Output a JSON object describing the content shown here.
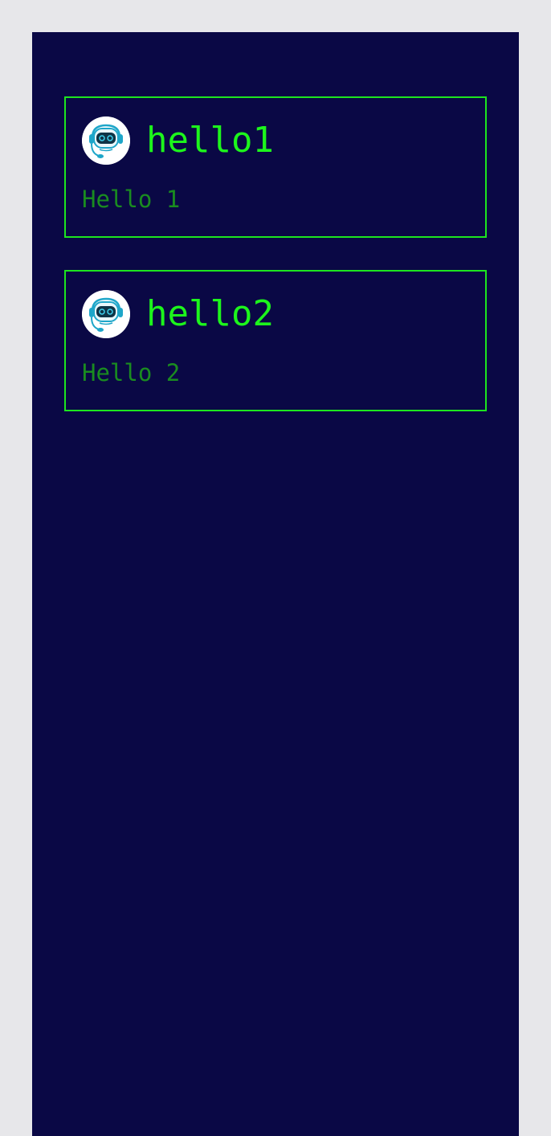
{
  "colors": {
    "outer_background": "#e7e7ea",
    "panel_background": "#0a0845",
    "card_border": "#1de51f",
    "title_text": "#1df51c",
    "body_text": "#1a8c20"
  },
  "cards": [
    {
      "avatar_icon": "robot-headset-icon",
      "title": "hello1",
      "message": "Hello 1"
    },
    {
      "avatar_icon": "robot-headset-icon",
      "title": "hello2",
      "message": "Hello 2"
    }
  ]
}
